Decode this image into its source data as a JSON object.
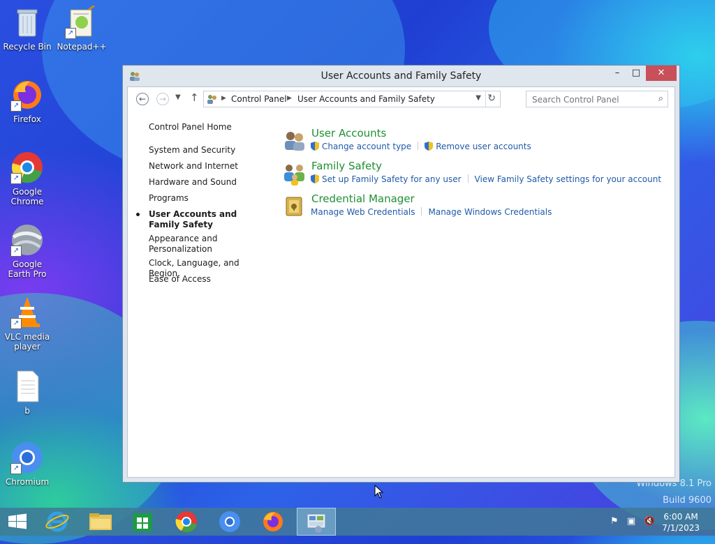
{
  "desktop": {
    "icons": [
      {
        "label": "Recycle Bin"
      },
      {
        "label": "Notepad++"
      },
      {
        "label": "Firefox"
      },
      {
        "label": "Google Chrome"
      },
      {
        "label": "Google Earth Pro"
      },
      {
        "label": "VLC media player"
      },
      {
        "label": "b"
      },
      {
        "label": "Chromium"
      }
    ],
    "watermark": {
      "line1": "Windows 8.1 Pro",
      "line2": "Build 9600"
    }
  },
  "window": {
    "title": "User Accounts and Family Safety",
    "controls": {
      "minimize": "–",
      "maximize": "□",
      "close": "✕"
    },
    "address": {
      "segments": [
        "Control Panel",
        "User Accounts and Family Safety"
      ]
    },
    "search": {
      "placeholder": "Search Control Panel"
    },
    "sidebar": {
      "items": [
        {
          "label": "Control Panel Home"
        },
        {
          "label": "System and Security"
        },
        {
          "label": "Network and Internet"
        },
        {
          "label": "Hardware and Sound"
        },
        {
          "label": "Programs"
        },
        {
          "label": "User Accounts and Family Safety",
          "active": true
        },
        {
          "label": "Appearance and Personalization"
        },
        {
          "label": "Clock, Language, and Region"
        },
        {
          "label": "Ease of Access"
        }
      ]
    },
    "categories": [
      {
        "title": "User Accounts",
        "icon": "user-accounts-icon",
        "links": [
          "Change account type",
          "Remove user accounts"
        ]
      },
      {
        "title": "Family Safety",
        "icon": "family-safety-icon",
        "links": [
          "Set up Family Safety for any user",
          "View Family Safety settings for your account"
        ]
      },
      {
        "title": "Credential Manager",
        "icon": "credential-manager-icon",
        "links": [
          "Manage Web Credentials",
          "Manage Windows Credentials"
        ]
      }
    ]
  },
  "taskbar": {
    "clock": {
      "time": "6:00 AM",
      "date": "7/1/2023"
    },
    "apps": [
      "start",
      "internet-explorer",
      "file-explorer",
      "store",
      "chrome",
      "chromium",
      "firefox",
      "control-panel"
    ]
  },
  "colors": {
    "link": "#1f5aa8",
    "category_title": "#1e8f33",
    "close_button": "#c7505a"
  }
}
